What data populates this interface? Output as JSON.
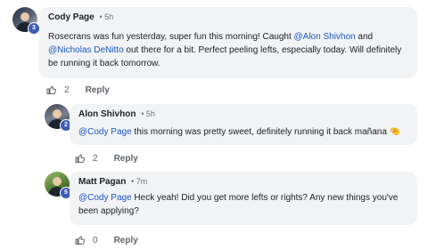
{
  "comments": [
    {
      "author": "Cody Page",
      "time": "5h",
      "level": "3",
      "text_before": "Rosecrans was fun yesterday, super fun this morning! Caught ",
      "mention1": "@Alon Shivhon",
      "text_between": " and ",
      "mention2": "@Nicholas DeNitto",
      "text_after": " out there for a bit. Perfect peeling lefts, especially today. Will definitely be running it back tomorrow.",
      "likes": "2",
      "reply_label": "Reply"
    },
    {
      "author": "Alon Shivhon",
      "time": "5h",
      "level": "2",
      "mention": "@Cody Page",
      "text_after": " this morning was pretty sweet, definitely running it back mañana 🤏",
      "likes": "2",
      "reply_label": "Reply"
    },
    {
      "author": "Matt Pagan",
      "time": "7m",
      "level": "5",
      "mention": "@Cody Page",
      "text_after": " Heck yeah! Did you get more lefts or rights? Any new things you've been applying?",
      "likes": "0",
      "reply_label": "Reply"
    }
  ],
  "separator": "•",
  "colors": {
    "mention": "#1a56c9",
    "bubble": "#f1f3f4",
    "badge": "#3d5bb8"
  },
  "icons": {
    "like": "thumbs-up-icon"
  }
}
